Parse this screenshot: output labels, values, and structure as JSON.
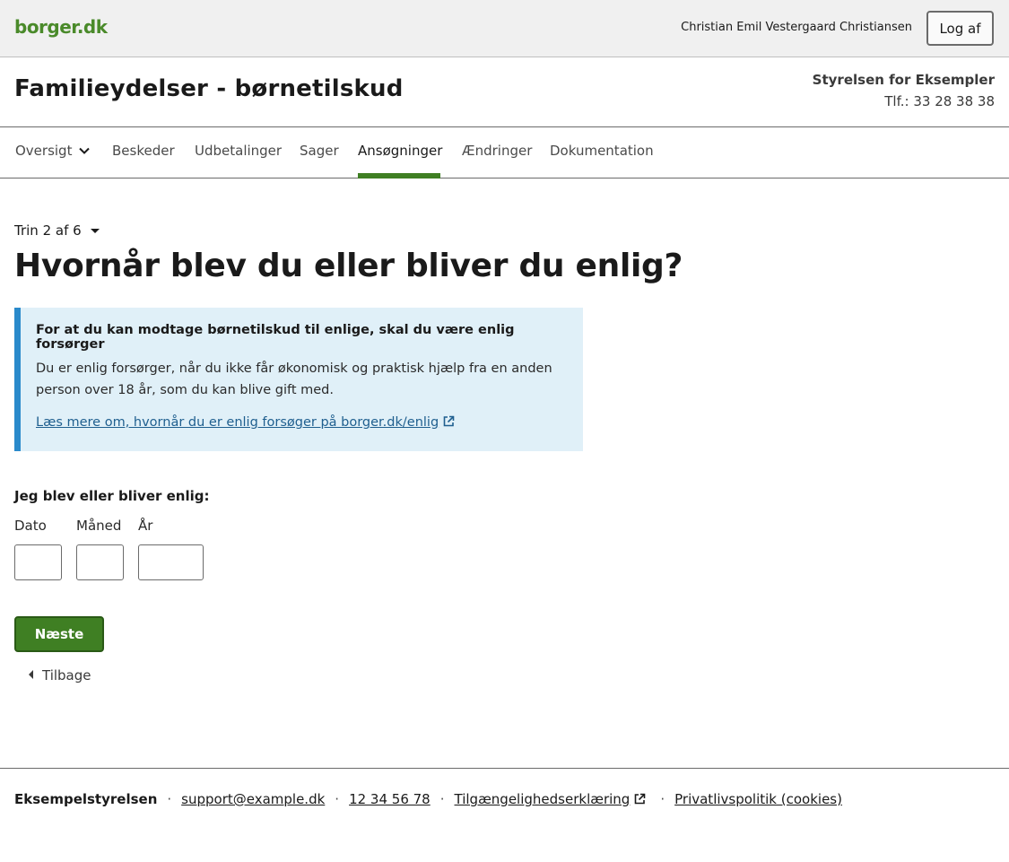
{
  "topbar": {
    "logo": "borger.dk",
    "user_name": "Christian Emil Vestergaard Christiansen",
    "logout_label": "Log af"
  },
  "header": {
    "title": "Familieydelser - børnetilskud",
    "org_name": "Styrelsen for Eksempler",
    "org_phone": "Tlf.: 33 28 38 38"
  },
  "nav": {
    "items": [
      {
        "label": "Oversigt",
        "icon": "chevron-down-icon"
      },
      {
        "label": "Beskeder"
      },
      {
        "label": "Udbetalinger"
      },
      {
        "label": "Sager"
      },
      {
        "label": "Ansøgninger",
        "active": true
      },
      {
        "label": "Ændringer"
      },
      {
        "label": "Dokumentation"
      }
    ],
    "active_color": "#3f7f23"
  },
  "main": {
    "step": "Trin 2 af 6",
    "question": "Hvornår blev du eller bliver du enlig?",
    "info": {
      "title": "For at du kan modtage børnetilskud til enlige, skal du være enlig forsørger",
      "body": "Du er enlig forsørger, når du ikke får økonomisk og praktisk hjælp fra en anden person over 18 år, som du kan blive gift med.",
      "link": "Læs mere om, hvornår du er enlig forsøger på borger.dk/enlig",
      "bg_color": "#e0f0f8",
      "accent_color": "#2a8acb"
    },
    "field_label": "Jeg blev eller bliver enlig:",
    "date_fields": {
      "day_label": "Dato",
      "month_label": "Måned",
      "year_label": "År",
      "day_value": "",
      "month_value": "",
      "year_value": ""
    },
    "next_label": "Næste",
    "back_label": "Tilbage"
  },
  "footer": {
    "org": "Eksempelstyrelsen",
    "email": "support@example.dk",
    "phone": "12 34 56 78",
    "accessibility": "Tilgængelighedserklæring",
    "privacy": "Privatlivspolitik (cookies)"
  }
}
